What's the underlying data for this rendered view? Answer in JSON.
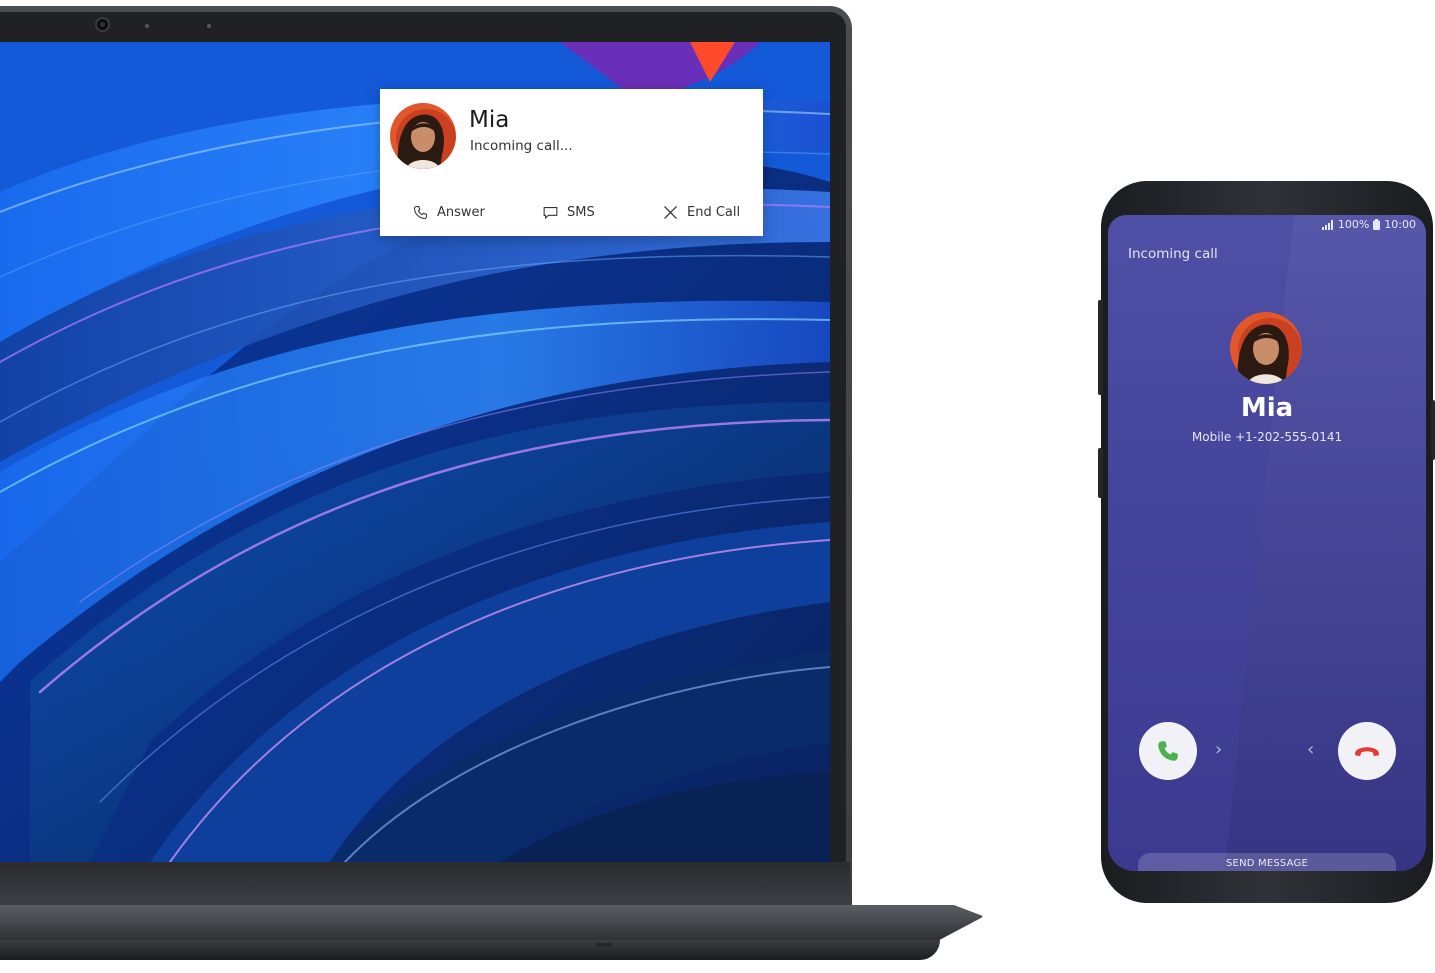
{
  "notification": {
    "caller_name": "Mia",
    "status": "Incoming call...",
    "actions": [
      {
        "label": "Answer",
        "icon": "phone-icon"
      },
      {
        "label": "SMS",
        "icon": "message-icon"
      },
      {
        "label": "End Call",
        "icon": "close-icon"
      }
    ]
  },
  "phone": {
    "status_bar": {
      "signal": "signal-icon",
      "battery_percent": "100%",
      "battery_icon": "battery-icon",
      "time": "10:00"
    },
    "incoming_label": "Incoming call",
    "caller_name": "Mia",
    "caller_number": "Mobile +1-202-555-0141",
    "answer_icon": "phone-answer-icon",
    "decline_icon": "phone-decline-icon",
    "swipe_right": "›",
    "swipe_left": "‹",
    "send_message": "SEND MESSAGE"
  },
  "colors": {
    "answer_green": "#4caf50",
    "decline_red": "#e53935",
    "phone_screen": "#4a4aa0",
    "wallpaper_blue": "#1a55d6"
  }
}
